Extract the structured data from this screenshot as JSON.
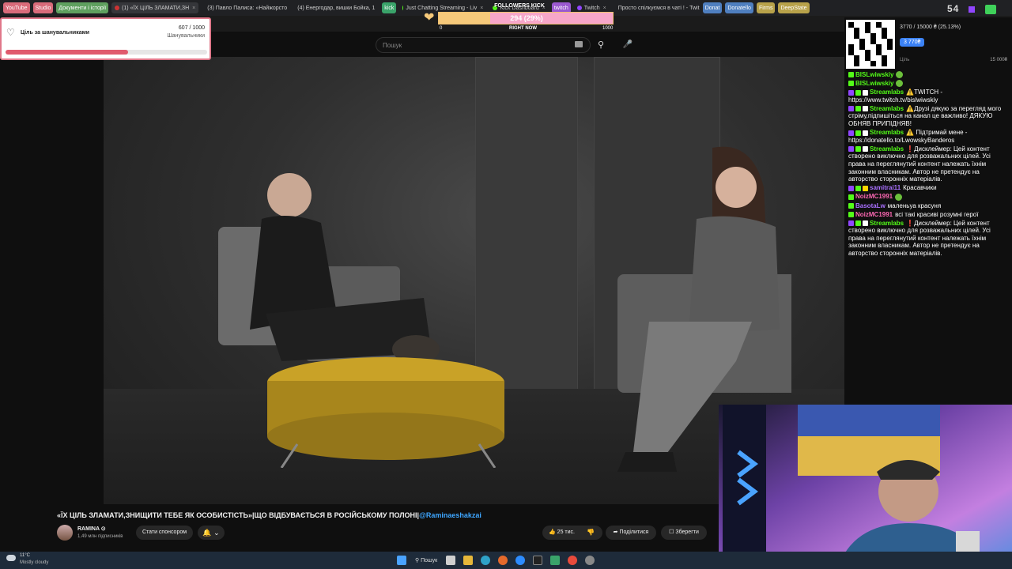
{
  "browser": {
    "tabs": [
      {
        "label": "YouTube",
        "kind": "pill",
        "color": "#d96b7a"
      },
      {
        "label": "Studio",
        "kind": "pill",
        "color": "#d96b7a"
      },
      {
        "label": "Документи і історії",
        "kind": "pill",
        "color": "#5fa05f"
      },
      {
        "label": "(1) «ЇХ ЦІЛЬ ЗЛАМАТИ,ЗН",
        "kind": "tab",
        "color": "#cc3333",
        "active": true
      },
      {
        "label": "(3) Павло Палиса: «Найжорсто",
        "kind": "tab",
        "color": "#cc3333"
      },
      {
        "label": "(4) Енергодар, вишки Бойка, 1",
        "kind": "tab",
        "color": "#cc3333"
      },
      {
        "label": "kick",
        "kind": "pill",
        "color": "#3aa36a"
      },
      {
        "label": "Just Chatting Streaming - Liv",
        "kind": "tab",
        "color": "#53fc18"
      },
      {
        "label": "Kick Dashboard",
        "kind": "tab",
        "color": "#53fc18"
      },
      {
        "label": "twitch",
        "kind": "pill",
        "color": "#9b59d0"
      },
      {
        "label": "Twitch",
        "kind": "tab",
        "color": "#9146ff"
      },
      {
        "label": "Просто спілкуємся в чаті ! - Twit",
        "kind": "tab",
        "color": "#9146ff"
      },
      {
        "label": "Donat",
        "kind": "pill",
        "color": "#4f7fbf"
      },
      {
        "label": "Donatello",
        "kind": "pill",
        "color": "#4f7fbf"
      },
      {
        "label": "Firms",
        "kind": "pill",
        "color": "#b8a24a"
      },
      {
        "label": "DeepState",
        "kind": "pill",
        "color": "#b8a24a"
      }
    ]
  },
  "youtube": {
    "search_placeholder": "Пошук",
    "video_title": "«ЇХ ЦІЛЬ ЗЛАМАТИ,ЗНИЩИТИ ТЕБЕ ЯК ОСОБИСТІСТЬ»|ЩО ВІДБУВАЄТЬСЯ В РОСІЙСЬКОМУ ПОЛОНІ|",
    "video_title_mention": "@Raminaeshakzai",
    "channel_name": "RAMINA",
    "channel_verified": "⊙",
    "subscribers": "1,49 млн підписників",
    "sponsor_label": "Стати спонсором",
    "bell_label": "🔔 ⌄",
    "likes": "25 тис.",
    "share_label": "Поділитися",
    "save_label": "Зберегти"
  },
  "follower_goal": {
    "title": "Ціль за шанувальниками",
    "count": "607 / 1000",
    "label": "Шанувальники",
    "progress": 0.607
  },
  "kick_widget": {
    "title": "FOLLOWERS KICK",
    "value_text": "294 (29%)",
    "progress": 0.294,
    "min": "0",
    "mid": "RIGHT NOW",
    "max": "1000"
  },
  "donation_goal": {
    "progress_text": "3770 / 15000 ₴ (25.13%)",
    "badge": "3 770₴",
    "min_label": "Ціль",
    "goal_label": "15 000₴"
  },
  "chat": [
    {
      "user": "BISLwiwskiy",
      "color": "#53fc18",
      "text": "",
      "emote": true,
      "badges": [
        "#53fc18"
      ]
    },
    {
      "user": "BISLwiwskiy",
      "color": "#53fc18",
      "text": "",
      "emote": true,
      "badges": [
        "#53fc18"
      ]
    },
    {
      "user": "Streamlabs",
      "color": "#53fc18",
      "text": "⚠️TWITCH - https://www.twitch.tv/bislwiwskiy",
      "badges": [
        "#9146ff",
        "#53fc18",
        "#ffffff"
      ]
    },
    {
      "user": "Streamlabs",
      "color": "#53fc18",
      "text": "⚠️Друзі дякую за перегляд мого стріму,підпишіться на канал це важливо! ДЯКУЮ ОБНЯВ ПРИПІДНЯВ!",
      "badges": [
        "#9146ff",
        "#53fc18",
        "#ffffff"
      ]
    },
    {
      "user": "Streamlabs",
      "color": "#53fc18",
      "text": "⚠️ Підтримай мене - https://donatello.to/LwowskyBanderos",
      "badges": [
        "#9146ff",
        "#53fc18",
        "#ffffff"
      ]
    },
    {
      "user": "Streamlabs",
      "color": "#53fc18",
      "text": "❗Дисклеймер: Цей контент створено виключно для розважальних цілей. Усі права на переглянутий контент належать їхнім законним власникам. Автор не претендує на авторство сторонніх матеріалів.",
      "badges": [
        "#9146ff",
        "#53fc18",
        "#ffffff"
      ]
    },
    {
      "user": "samitrai11",
      "color": "#a970ff",
      "text": "Красавчики",
      "badges": [
        "#9146ff",
        "#53fc18",
        "#ffd700"
      ]
    },
    {
      "user": "NoizMC1991",
      "color": "#ff69b4",
      "text": "",
      "emote": true,
      "badges": [
        "#53fc18"
      ]
    },
    {
      "user": "BasotaLw",
      "color": "#a970ff",
      "text": "маленьуа красуня",
      "badges": [
        "#53fc18"
      ]
    },
    {
      "user": "NoizMC1991",
      "color": "#ff69b4",
      "text": "всі такі красиві розумні герої",
      "badges": [
        "#53fc18"
      ]
    },
    {
      "user": "Streamlabs",
      "color": "#53fc18",
      "text": "❗Дисклеймер: Цей контент створено виключно для розважальних цілей. Усі права на переглянутий контент належать їхнім законним власникам. Автор не претендує на авторство сторонніх матеріалів.",
      "badges": [
        "#9146ff",
        "#53fc18",
        "#ffffff"
      ]
    }
  ],
  "overlay_number": "54",
  "taskbar": {
    "weather_temp": "11°C",
    "weather_desc": "Mostly cloudy",
    "search_label": "Пошук"
  },
  "colors": {
    "accent_red": "#e05a6d",
    "kick_green": "#53fc18",
    "twitch_purple": "#9146ff",
    "yt_link_blue": "#3ea6ff"
  }
}
